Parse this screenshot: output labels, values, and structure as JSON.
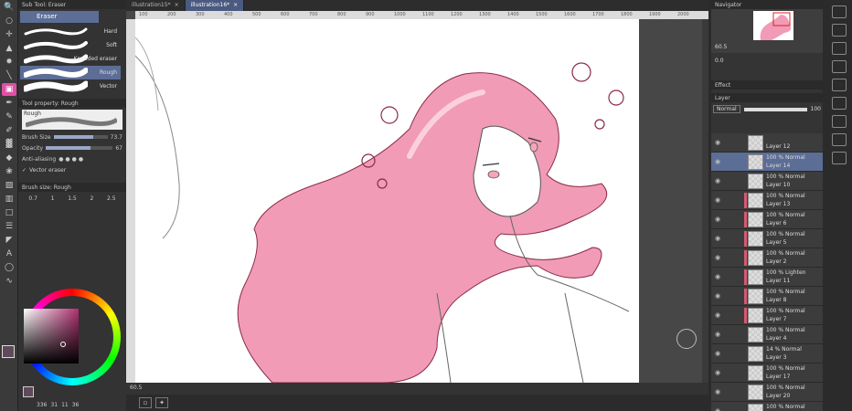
{
  "tabs": [
    {
      "label": "illustration15*",
      "active": false
    },
    {
      "label": "illustration16*",
      "active": true
    }
  ],
  "subtool": {
    "panel_title": "Sub Tool: Eraser",
    "tab_label": "Eraser",
    "brushes": [
      {
        "label": "Hard",
        "selected": false
      },
      {
        "label": "Soft",
        "selected": false
      },
      {
        "label": "Kneaded eraser",
        "selected": false
      },
      {
        "label": "Rough",
        "selected": true
      },
      {
        "label": "Vector",
        "selected": false
      }
    ]
  },
  "tool_property": {
    "title": "Tool property: Rough",
    "preview_label": "Rough",
    "brush_size_label": "Brush Size",
    "brush_size_value": "73.7",
    "brush_size_fraction": 0.74,
    "opacity_label": "Opacity",
    "opacity_value": "67",
    "opacity_fraction": 0.67,
    "antialias_label": "Anti-aliasing",
    "vector_eraser_label": "Vector eraser"
  },
  "brush_size_panel": {
    "title": "Brush size: Rough",
    "sizes": [
      "0.7",
      "1",
      "1.5",
      "2",
      "2.5"
    ]
  },
  "status": {
    "coord": "336",
    "value2": "31",
    "value3": "11",
    "value4": "36"
  },
  "zoom": "60.5",
  "navigator": {
    "title": "Navigator",
    "zoom": "60.5",
    "angle": "0.0"
  },
  "layers_panel": {
    "effect_label": "Effect",
    "layer_label": "Layer",
    "blend_mode": "Normal",
    "opacity": "100"
  },
  "layers": [
    {
      "mode": "",
      "name": "Layer 12",
      "selected": false,
      "clipped": false
    },
    {
      "mode": "100 % Normal",
      "name": "Layer 14",
      "selected": true,
      "clipped": false
    },
    {
      "mode": "100 % Normal",
      "name": "Layer 10",
      "selected": false,
      "clipped": false
    },
    {
      "mode": "100 % Normal",
      "name": "Layer 13",
      "selected": false,
      "clipped": true
    },
    {
      "mode": "100 % Normal",
      "name": "Layer 6",
      "selected": false,
      "clipped": true
    },
    {
      "mode": "100 % Normal",
      "name": "Layer 5",
      "selected": false,
      "clipped": true
    },
    {
      "mode": "100 % Normal",
      "name": "Layer 2",
      "selected": false,
      "clipped": true
    },
    {
      "mode": "100 % Lighten",
      "name": "Layer 11",
      "selected": false,
      "clipped": true
    },
    {
      "mode": "100 % Normal",
      "name": "Layer 8",
      "selected": false,
      "clipped": true
    },
    {
      "mode": "100 % Normal",
      "name": "Layer 7",
      "selected": false,
      "clipped": true
    },
    {
      "mode": "100 % Normal",
      "name": "Layer 4",
      "selected": false,
      "clipped": false
    },
    {
      "mode": "14 % Normal",
      "name": "Layer 3",
      "selected": false,
      "clipped": false
    },
    {
      "mode": "100 % Normal",
      "name": "Layer 17",
      "selected": false,
      "clipped": false
    },
    {
      "mode": "100 % Normal",
      "name": "Layer 20",
      "selected": false,
      "clipped": false
    },
    {
      "mode": "100 % Normal",
      "name": "",
      "selected": false,
      "clipped": false
    }
  ],
  "ruler_ticks": [
    "100",
    "200",
    "300",
    "400",
    "500",
    "600",
    "700",
    "800",
    "900",
    "1000",
    "1100",
    "1200",
    "1300",
    "1400",
    "1500",
    "1600",
    "1700",
    "1800",
    "1900",
    "2000"
  ],
  "colors": {
    "accent": "#5c6d96",
    "hair": "#f19bb6",
    "active_tool": "#e04fa6"
  }
}
